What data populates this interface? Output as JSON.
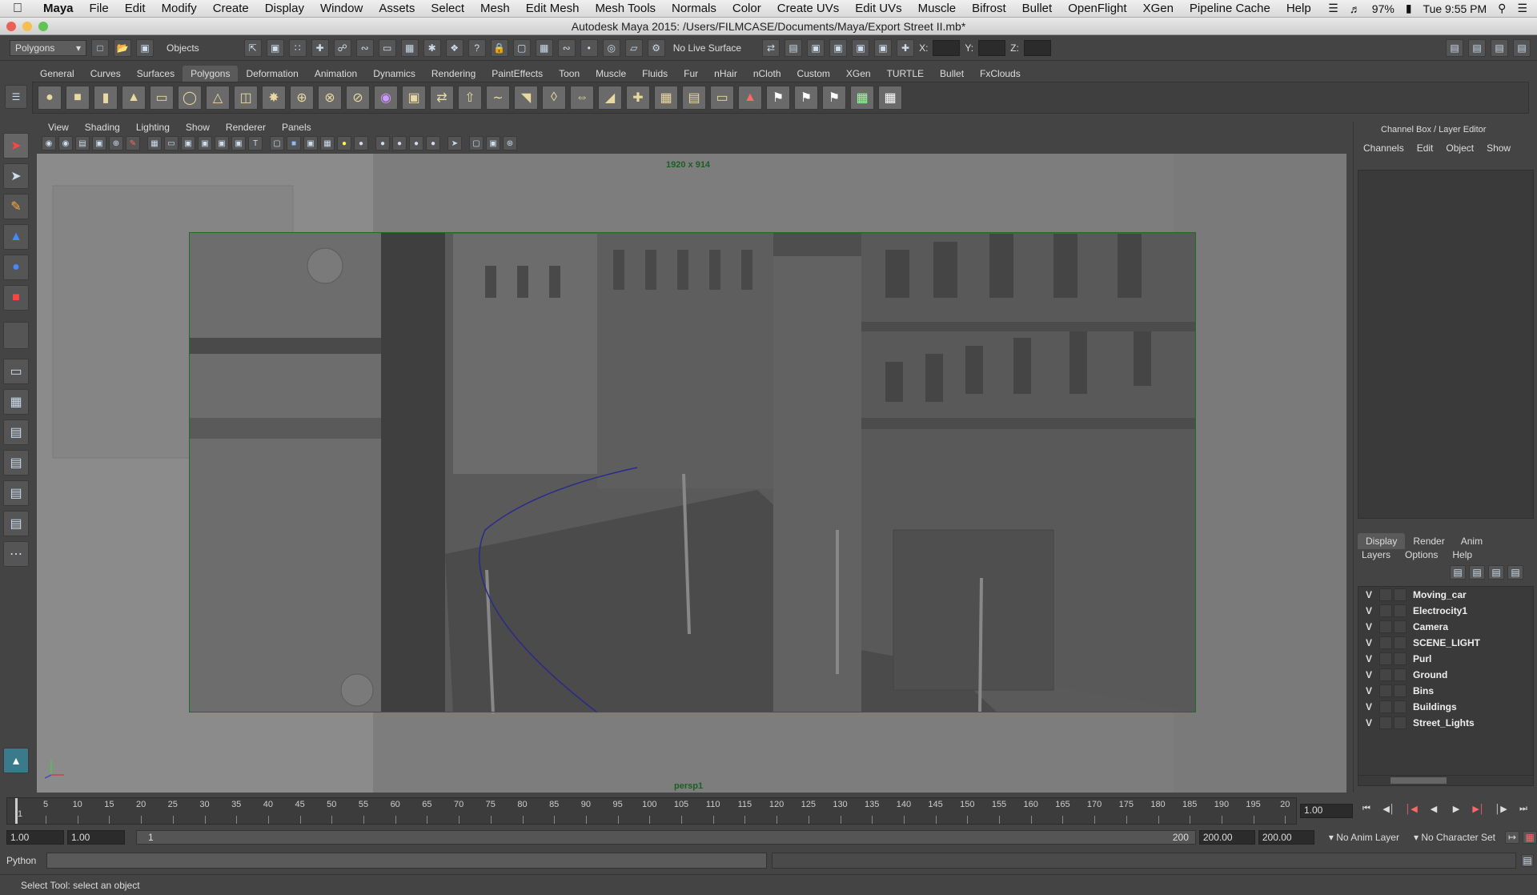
{
  "menubar": {
    "app": "Maya",
    "items": [
      "File",
      "Edit",
      "Modify",
      "Create",
      "Display",
      "Window",
      "Assets",
      "Select",
      "Mesh",
      "Edit Mesh",
      "Mesh Tools",
      "Normals",
      "Color",
      "Create UVs",
      "Edit UVs",
      "Muscle",
      "Bifrost",
      "Bullet",
      "OpenFlight",
      "XGen",
      "Pipeline Cache",
      "Help"
    ],
    "battery": "97%",
    "clock": "Tue 9:55 PM"
  },
  "window": {
    "title": "Autodesk Maya 2015: /Users/FILMCASE/Documents/Maya/Export Street II.mb*"
  },
  "statusline": {
    "menu_set": "Polygons",
    "selection_mode": "Objects",
    "live_surface": "No Live Surface",
    "x_label": "X:",
    "y_label": "Y:",
    "z_label": "Z:"
  },
  "shelf": {
    "tabs": [
      "General",
      "Curves",
      "Surfaces",
      "Polygons",
      "Deformation",
      "Animation",
      "Dynamics",
      "Rendering",
      "PaintEffects",
      "Toon",
      "Muscle",
      "Fluids",
      "Fur",
      "nHair",
      "nCloth",
      "Custom",
      "XGen",
      "TURTLE",
      "Bullet",
      "FxClouds"
    ],
    "active_tab": "Polygons"
  },
  "panel": {
    "menus": [
      "View",
      "Shading",
      "Lighting",
      "Show",
      "Renderer",
      "Panels"
    ],
    "resolution": "1920 x 914",
    "camera": "persp1"
  },
  "channel_box": {
    "title": "Channel Box / Layer Editor",
    "menus": [
      "Channels",
      "Edit",
      "Object",
      "Show"
    ]
  },
  "layer_editor": {
    "tabs": [
      "Display",
      "Render",
      "Anim"
    ],
    "active_tab": "Display",
    "menus": [
      "Layers",
      "Options",
      "Help"
    ],
    "layers": [
      {
        "visible": "V",
        "name": "Moving_car"
      },
      {
        "visible": "V",
        "name": "Electrocity1"
      },
      {
        "visible": "V",
        "name": "Camera"
      },
      {
        "visible": "V",
        "name": "SCENE_LIGHT"
      },
      {
        "visible": "V",
        "name": "Purl"
      },
      {
        "visible": "V",
        "name": "Ground"
      },
      {
        "visible": "V",
        "name": "Bins"
      },
      {
        "visible": "V",
        "name": "Buildings"
      },
      {
        "visible": "V",
        "name": "Street_Lights"
      }
    ]
  },
  "timeline": {
    "start_label": "1",
    "ticks": [
      "5",
      "10",
      "15",
      "20",
      "25",
      "30",
      "35",
      "40",
      "45",
      "50",
      "55",
      "60",
      "65",
      "70",
      "75",
      "80",
      "85",
      "90",
      "95",
      "100",
      "105",
      "110",
      "115",
      "120",
      "125",
      "130",
      "135",
      "140",
      "145",
      "150",
      "155",
      "160",
      "165",
      "170",
      "175",
      "180",
      "185",
      "190",
      "195",
      "20"
    ],
    "current_frame": "1.00"
  },
  "range": {
    "start": "1.00",
    "playback_start": "1.00",
    "slider_start": "1",
    "slider_end": "200",
    "playback_end": "200.00",
    "end": "200.00",
    "anim_layer": "No Anim Layer",
    "character_set": "No Character Set"
  },
  "command_line": {
    "language": "Python"
  },
  "help_line": {
    "text": "Select Tool: select an object"
  },
  "colors": {
    "viewport": "#7b7b7b",
    "gate": "#1e6b2a",
    "curve": "#2a2a8a"
  }
}
